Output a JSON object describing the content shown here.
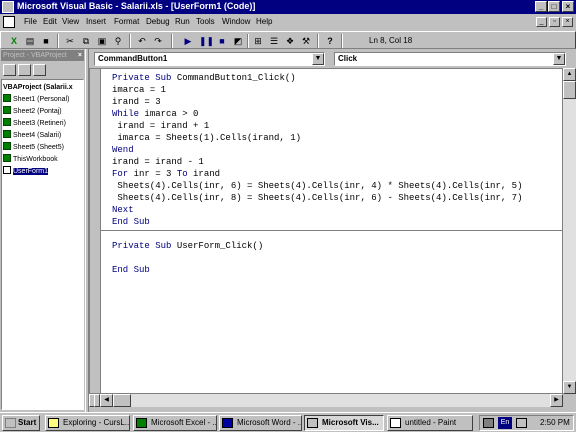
{
  "window": {
    "title": "Microsoft Visual Basic - Salarii.xls - [UserForm1 (Code)]"
  },
  "menu": [
    "File",
    "Edit",
    "View",
    "Insert",
    "Format",
    "Debug",
    "Run",
    "Tools",
    "Window",
    "Help"
  ],
  "toolbar": {
    "position": "Ln 8, Col 18"
  },
  "project": {
    "panel_title": "Project - VBAProject",
    "root": "VBAProject (Salarii.x",
    "items": [
      "Sheet1 (Personal)",
      "Sheet2 (Pontaj)",
      "Sheet3 (Retineri)",
      "Sheet4 (Salarii)",
      "Sheet5 (Sheet5)",
      "ThisWorkbook",
      "UserForm1"
    ]
  },
  "code": {
    "object_combo": "CommandButton1",
    "procedure_combo": "Click",
    "lines": [
      "Private Sub CommandButton1_Click()",
      "imarca = 1",
      "irand = 3",
      "While imarca > 0",
      " irand = irand + 1",
      " imarca = Sheets(1).Cells(irand, 1)",
      "Wend",
      "irand = irand - 1",
      "For inr = 3 To irand",
      " Sheets(4).Cells(inr, 6) = Sheets(4).Cells(inr, 4) * Sheets(4).Cells(inr, 5)",
      " Sheets(4).Cells(inr, 8) = Sheets(4).Cells(inr, 6) - Sheets(4).Cells(inr, 7)",
      "Next",
      "End Sub",
      "",
      "Private Sub UserForm_Click()",
      "",
      "End Sub"
    ]
  },
  "taskbar": {
    "start": "Start",
    "tasks": [
      "Exploring - CursL...",
      "Microsoft Excel - ...",
      "Microsoft Word - ...",
      "Microsoft Vis...",
      "untitled - Paint"
    ],
    "tray_lang": "En",
    "clock": "2:50 PM"
  },
  "colors": {
    "titlebar": "#000080",
    "keyword": "#00007f",
    "face": "#c0c0c0"
  }
}
